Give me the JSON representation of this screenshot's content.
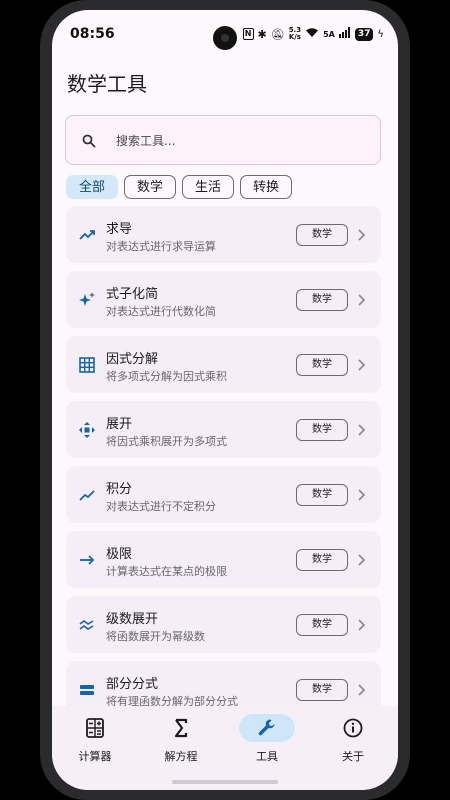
{
  "status": {
    "time": "08:56",
    "speed_top": "5.3",
    "speed_bottom": "K/s",
    "network": "5A",
    "battery": "37"
  },
  "page_title": "数学工具",
  "search": {
    "placeholder": "搜索工具..."
  },
  "chips": [
    {
      "label": "全部",
      "active": true
    },
    {
      "label": "数学",
      "active": false
    },
    {
      "label": "生活",
      "active": false
    },
    {
      "label": "转换",
      "active": false
    }
  ],
  "tools": [
    {
      "title": "求导",
      "desc": "对表达式进行求导运算",
      "tag": "数学",
      "icon": "trending-up-icon"
    },
    {
      "title": "式子化简",
      "desc": "对表达式进行代数化简",
      "tag": "数学",
      "icon": "sparkle-icon"
    },
    {
      "title": "因式分解",
      "desc": "将多项式分解为因式乘积",
      "tag": "数学",
      "icon": "grid-icon"
    },
    {
      "title": "展开",
      "desc": "将因式乘积展开为多项式",
      "tag": "数学",
      "icon": "expand-arrows-icon"
    },
    {
      "title": "积分",
      "desc": "对表达式进行不定积分",
      "tag": "数学",
      "icon": "integral-curve-icon"
    },
    {
      "title": "极限",
      "desc": "计算表达式在某点的极限",
      "tag": "数学",
      "icon": "arrow-right-icon"
    },
    {
      "title": "级数展开",
      "desc": "将函数展开为幂级数",
      "tag": "数学",
      "icon": "series-icon"
    },
    {
      "title": "部分分式",
      "desc": "将有理函数分解为部分分式",
      "tag": "数学",
      "icon": "fraction-icon"
    }
  ],
  "nav": [
    {
      "label": "计算器",
      "icon": "calculator-icon",
      "active": false
    },
    {
      "label": "解方程",
      "icon": "sigma-icon",
      "active": false
    },
    {
      "label": "工具",
      "icon": "wrench-icon",
      "active": true
    },
    {
      "label": "关于",
      "icon": "info-icon",
      "active": false
    }
  ],
  "colors": {
    "accent": "#1565a8",
    "active_pill": "#cfe5f8",
    "card_bg": "#f5eef6"
  }
}
